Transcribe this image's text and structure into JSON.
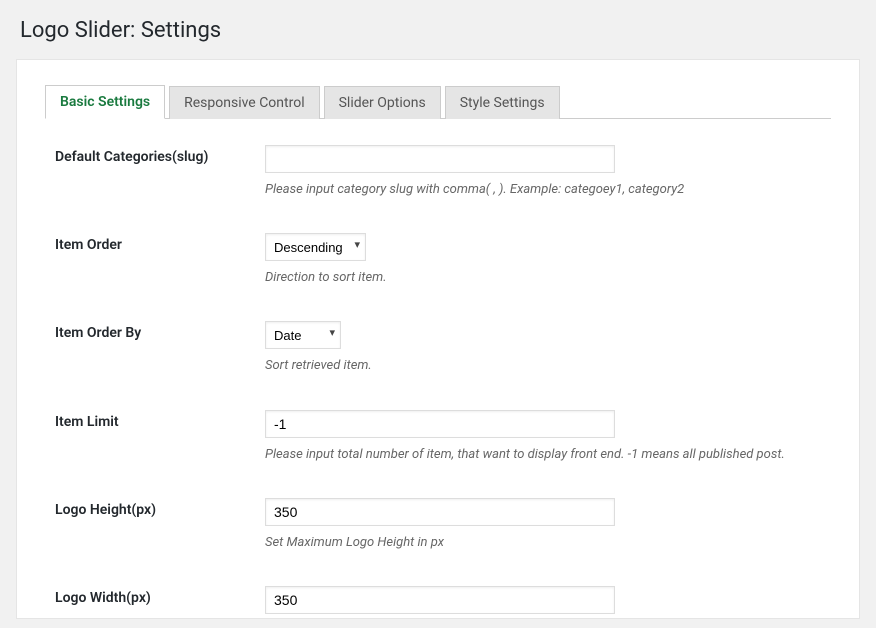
{
  "header": {
    "title": "Logo Slider: Settings"
  },
  "tabs": [
    {
      "label": "Basic Settings",
      "active": true
    },
    {
      "label": "Responsive Control",
      "active": false
    },
    {
      "label": "Slider Options",
      "active": false
    },
    {
      "label": "Style Settings",
      "active": false
    }
  ],
  "fields": {
    "default_categories": {
      "label": "Default Categories(slug)",
      "value": "",
      "desc": "Please input category slug with comma( , ). Example: categoey1, category2"
    },
    "item_order": {
      "label": "Item Order",
      "value": "Descending",
      "desc": "Direction to sort item."
    },
    "item_order_by": {
      "label": "Item Order By",
      "value": "Date",
      "desc": "Sort retrieved item."
    },
    "item_limit": {
      "label": "Item Limit",
      "value": "-1",
      "desc": "Please input total number of item, that want to display front end. -1 means all published post."
    },
    "logo_height": {
      "label": "Logo Height(px)",
      "value": "350",
      "desc": "Set Maximum Logo Height in px"
    },
    "logo_width": {
      "label": "Logo Width(px)",
      "value": "350",
      "desc": ""
    }
  }
}
